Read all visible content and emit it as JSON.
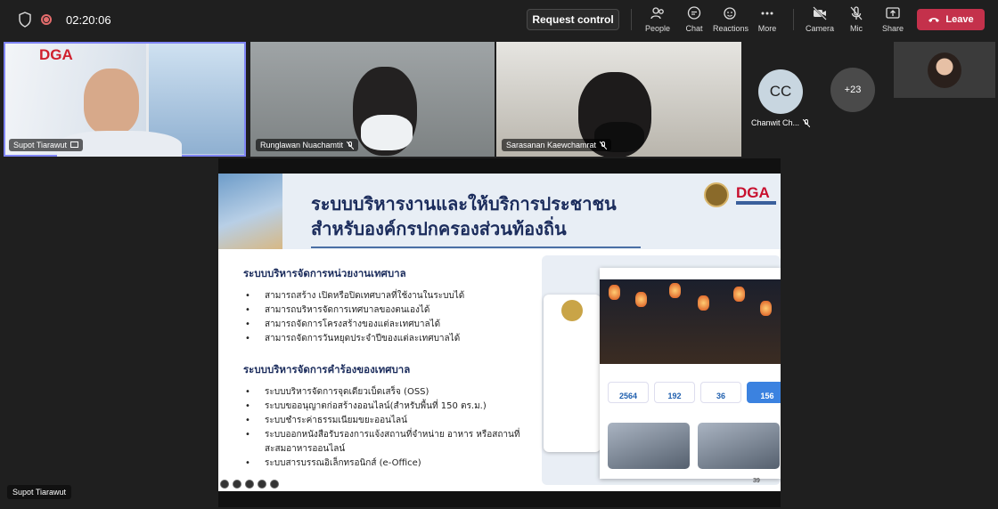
{
  "call": {
    "timer": "02:20:06",
    "request_control_label": "Request control",
    "toolbar": [
      {
        "id": "people",
        "label": "People",
        "icon": "people-icon"
      },
      {
        "id": "chat",
        "label": "Chat",
        "icon": "chat-icon"
      },
      {
        "id": "reactions",
        "label": "Reactions",
        "icon": "reactions-icon"
      },
      {
        "id": "more",
        "label": "More",
        "icon": "more-icon"
      },
      {
        "id": "camera",
        "label": "Camera",
        "icon": "camera-off-icon"
      },
      {
        "id": "mic",
        "label": "Mic",
        "icon": "mic-off-icon"
      },
      {
        "id": "share",
        "label": "Share",
        "icon": "share-icon"
      }
    ],
    "leave_label": "Leave",
    "accent_color": "#7f85f5",
    "leave_color": "#c4314b"
  },
  "participants": [
    {
      "name": "Supot Tiarawut",
      "status_icon": "screen-share-icon",
      "speaking": true
    },
    {
      "name": "Runglawan Nuachamtit",
      "status_icon": "mic-off-icon"
    },
    {
      "name": "Sarasanan Kaewchamrat",
      "status_icon": "mic-off-icon"
    }
  ],
  "cc_participant": {
    "initials": "CC",
    "name": "Chanwit Ch...",
    "status_icon": "mic-off-icon"
  },
  "overflow_count": "+23",
  "presenter_name": "Supot Tiarawut",
  "tile_logo": "DGA",
  "slide": {
    "title_line1": "ระบบบริหารงานและให้บริการประชาชน",
    "title_line2": "สำหรับองค์กรปกครองส่วนท้องถิ่น",
    "logo": "DGA",
    "section1": "ระบบบริหารจัดการหน่วยงานเทศบาล",
    "section1_items": [
      "สามารถสร้าง เปิดหรือปิดเทศบาลที่ใช้งานในระบบได้",
      "สามารถบริหารจัดการเทศบาลของตนเองได้",
      "สามารถจัดการโครงสร้างของแต่ละเทศบาลได้",
      "สามารถจัดการวันหยุดประจำปีของแต่ละเทศบาลได้"
    ],
    "section2": "ระบบบริหารจัดการคำร้องของเทศบาล",
    "section2_items": [
      "ระบบบริหารจัดการจุดเดียวเบ็ดเสร็จ (OSS)",
      "ระบบขออนุญาตก่อสร้างออนไลน์(สำหรับพื้นที่ 150 ตร.ม.)",
      "ระบบชำระค่าธรรมเนียมขยะออนไลน์",
      "ระบบออกหนังสือรับรองการแจ้งสถานที่จำหน่าย อาหาร หรือสถานที่สะสมอาหารออนไลน์",
      "ระบบสารบรรณอิเล็กทรอนิกส์ (e-Office)"
    ],
    "stats": [
      "2564",
      "192",
      "36",
      "156"
    ],
    "page_number": "39"
  }
}
